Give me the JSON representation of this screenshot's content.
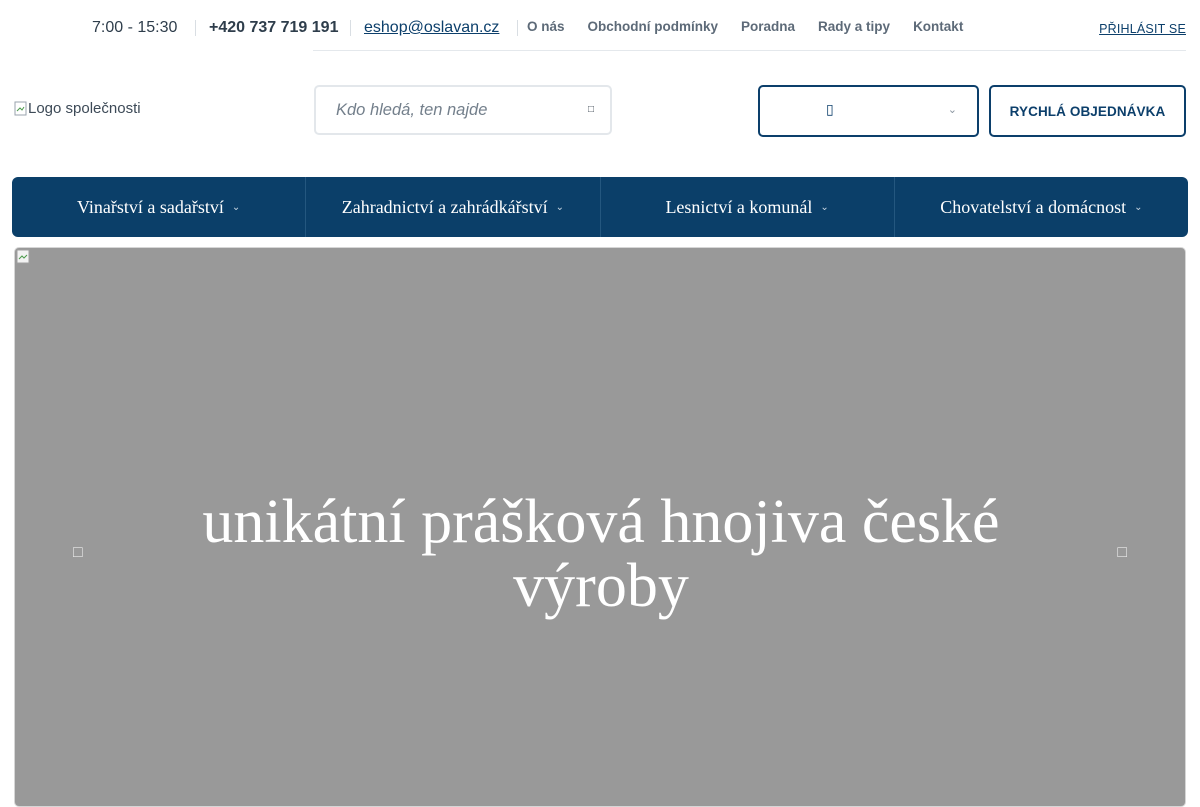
{
  "topbar": {
    "hours": "7:00 - 15:30",
    "phone": "+420 737 719 191",
    "email": "eshop@oslavan.cz",
    "links": [
      "O nás",
      "Obchodní podmínky",
      "Poradna",
      "Rady a tipy",
      "Kontakt"
    ],
    "login": "PŘIHLÁSIT SE"
  },
  "header": {
    "logo_alt": "Logo společnosti",
    "search_placeholder": "Kdo hledá, ten najde",
    "search_icon": "search-icon",
    "cart_icon": "cart-icon",
    "quick_order": "RYCHLÁ OBJEDNÁVKA"
  },
  "nav": {
    "items": [
      "Vinařství a sadařství",
      "Zahradnictví a zahrádkářství",
      "Lesnictví a komunál",
      "Chovatelství a domácnost"
    ]
  },
  "hero": {
    "title": "unikátní prášková hnojiva české výroby"
  },
  "colors": {
    "brand": "#0b3f69",
    "hero_bg": "#999999"
  }
}
